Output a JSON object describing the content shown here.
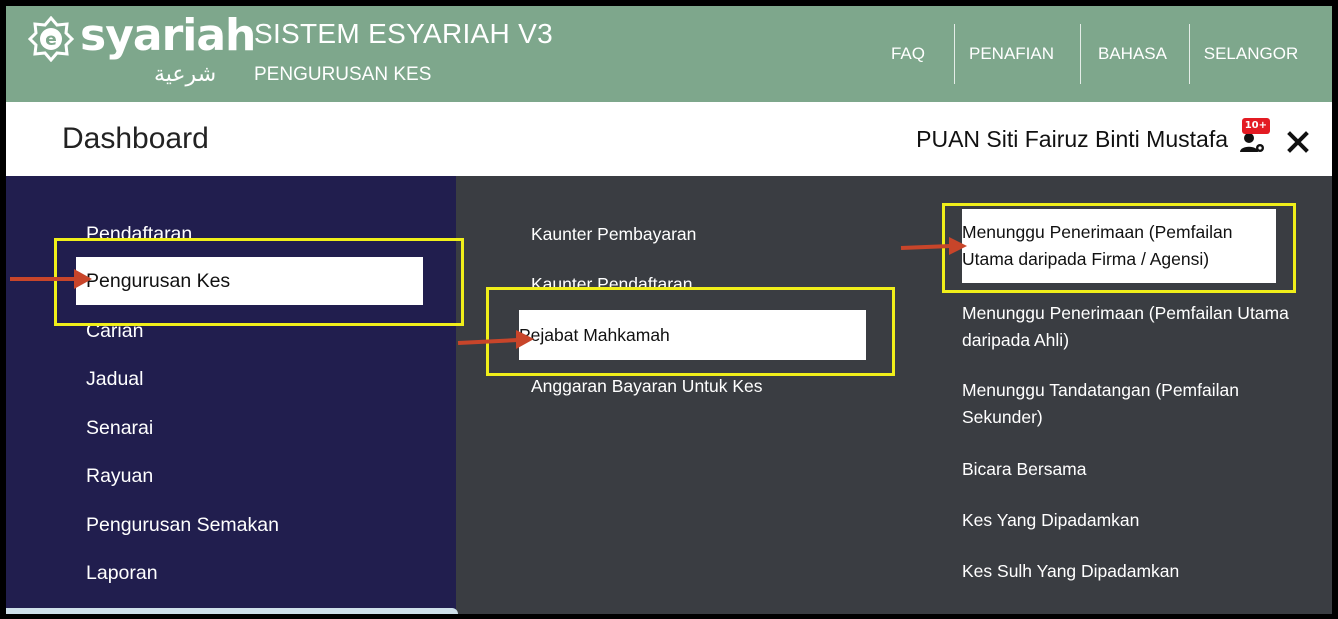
{
  "header": {
    "logo_word": "syariah",
    "logo_arabic": "شرعية",
    "app_title": "SISTEM ESYARIAH V3",
    "app_subtitle": "PENGURUSAN KES",
    "nav": [
      "FAQ",
      "PENAFIAN",
      "BAHASA",
      "SELANGOR"
    ],
    "bg_color": "#7ea78c"
  },
  "titlebar": {
    "page_title": "Dashboard",
    "user_name": "PUAN Siti Fairuz Binti Mustafa",
    "notification_badge": "10+"
  },
  "menu_level1": {
    "items": [
      "Pendaftaran",
      "Pengurusan Kes",
      "Carian",
      "Jadual",
      "Senarai",
      "Rayuan",
      "Pengurusan Semakan",
      "Laporan"
    ],
    "selected": "Pengurusan Kes",
    "bg_color": "#211e4e"
  },
  "menu_level2": {
    "items": [
      "Kaunter Pembayaran",
      "Kaunter Pendaftaran",
      "Pejabat Mahkamah",
      "Anggaran Bayaran Untuk Kes"
    ],
    "selected": "Pejabat Mahkamah",
    "bg_color": "#3a3d42"
  },
  "menu_level3": {
    "items": [
      "Menunggu Penerimaan (Pemfailan Utama daripada Firma / Agensi)",
      "Menunggu Penerimaan (Pemfailan Utama daripada Ahli)",
      "Menunggu Tandatangan (Pemfailan Sekunder)",
      "Bicara Bersama",
      "Kes Yang Dipadamkan",
      "Kes Sulh Yang Dipadamkan"
    ],
    "selected": "Menunggu Penerimaan (Pemfailan Utama daripada Firma / Agensi)"
  },
  "annotation_colors": {
    "highlight": "#f0ef1a",
    "arrow": "#c8452a"
  }
}
